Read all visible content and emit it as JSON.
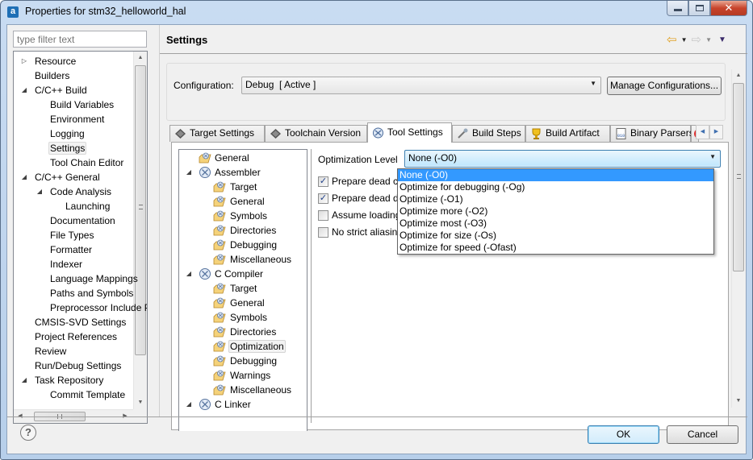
{
  "window": {
    "title": "Properties for stm32_helloworld_hal",
    "app_icon": "a",
    "controls": {
      "minimize": "minimize-icon",
      "maximize": "maximize-icon",
      "close": "close-icon"
    }
  },
  "left": {
    "filter_placeholder": "type filter text",
    "tree": [
      {
        "label": "Resource",
        "indent": 1,
        "twisty": "collapsed"
      },
      {
        "label": "Builders",
        "indent": 1,
        "twisty": "none"
      },
      {
        "label": "C/C++ Build",
        "indent": 1,
        "twisty": "expanded"
      },
      {
        "label": "Build Variables",
        "indent": 2,
        "twisty": "none"
      },
      {
        "label": "Environment",
        "indent": 2,
        "twisty": "none"
      },
      {
        "label": "Logging",
        "indent": 2,
        "twisty": "none"
      },
      {
        "label": "Settings",
        "indent": 2,
        "twisty": "none",
        "selected": true
      },
      {
        "label": "Tool Chain Editor",
        "indent": 2,
        "twisty": "none"
      },
      {
        "label": "C/C++ General",
        "indent": 1,
        "twisty": "expanded"
      },
      {
        "label": "Code Analysis",
        "indent": 2,
        "twisty": "expanded"
      },
      {
        "label": "Launching",
        "indent": 3,
        "twisty": "none"
      },
      {
        "label": "Documentation",
        "indent": 2,
        "twisty": "none"
      },
      {
        "label": "File Types",
        "indent": 2,
        "twisty": "none"
      },
      {
        "label": "Formatter",
        "indent": 2,
        "twisty": "none"
      },
      {
        "label": "Indexer",
        "indent": 2,
        "twisty": "none"
      },
      {
        "label": "Language Mappings",
        "indent": 2,
        "twisty": "none"
      },
      {
        "label": "Paths and Symbols",
        "indent": 2,
        "twisty": "none"
      },
      {
        "label": "Preprocessor Include Paths",
        "indent": 2,
        "twisty": "none"
      },
      {
        "label": "CMSIS-SVD Settings",
        "indent": 1,
        "twisty": "none"
      },
      {
        "label": "Project References",
        "indent": 1,
        "twisty": "none"
      },
      {
        "label": "Review",
        "indent": 1,
        "twisty": "none"
      },
      {
        "label": "Run/Debug Settings",
        "indent": 1,
        "twisty": "none"
      },
      {
        "label": "Task Repository",
        "indent": 1,
        "twisty": "expanded"
      },
      {
        "label": "Commit Template",
        "indent": 2,
        "twisty": "none"
      }
    ]
  },
  "main": {
    "title": "Settings",
    "nav": {
      "back": "back-arrow-icon",
      "forward": "forward-arrow-icon",
      "menu": "view-menu-icon"
    },
    "configuration": {
      "label": "Configuration:",
      "value": "Debug  [ Active ]",
      "manage_button": "Manage Configurations..."
    },
    "tabs": [
      {
        "label": "Target Settings",
        "icon": "target-settings-icon"
      },
      {
        "label": "Toolchain Version",
        "icon": "toolchain-version-icon"
      },
      {
        "label": "Tool Settings",
        "icon": "tool-settings-icon",
        "active": true
      },
      {
        "label": "Build Steps",
        "icon": "build-steps-icon"
      },
      {
        "label": "Build Artifact",
        "icon": "build-artifact-icon"
      },
      {
        "label": "Binary Parsers",
        "icon": "binary-parsers-icon"
      }
    ],
    "tool_tree": [
      {
        "label": "General",
        "indent": 1,
        "type": "option",
        "twisty": "none"
      },
      {
        "label": "Assembler",
        "indent": 1,
        "type": "tool",
        "twisty": "expanded"
      },
      {
        "label": "Target",
        "indent": 2,
        "type": "option"
      },
      {
        "label": "General",
        "indent": 2,
        "type": "option"
      },
      {
        "label": "Symbols",
        "indent": 2,
        "type": "option"
      },
      {
        "label": "Directories",
        "indent": 2,
        "type": "option"
      },
      {
        "label": "Debugging",
        "indent": 2,
        "type": "option"
      },
      {
        "label": "Miscellaneous",
        "indent": 2,
        "type": "option"
      },
      {
        "label": "C Compiler",
        "indent": 1,
        "type": "tool",
        "twisty": "expanded"
      },
      {
        "label": "Target",
        "indent": 2,
        "type": "option"
      },
      {
        "label": "General",
        "indent": 2,
        "type": "option"
      },
      {
        "label": "Symbols",
        "indent": 2,
        "type": "option"
      },
      {
        "label": "Directories",
        "indent": 2,
        "type": "option"
      },
      {
        "label": "Optimization",
        "indent": 2,
        "type": "option",
        "selected": true
      },
      {
        "label": "Debugging",
        "indent": 2,
        "type": "option"
      },
      {
        "label": "Warnings",
        "indent": 2,
        "type": "option"
      },
      {
        "label": "Miscellaneous",
        "indent": 2,
        "type": "option"
      },
      {
        "label": "C Linker",
        "indent": 1,
        "type": "tool",
        "twisty": "expanded"
      }
    ],
    "optimization": {
      "level_label": "Optimization Level",
      "level_value": "None (-O0)",
      "options": [
        {
          "label": "Prepare dead code removal",
          "visible_label": "Prepare dead cod",
          "checked": true
        },
        {
          "label": "Prepare dead data removal",
          "visible_label": "Prepare dead data",
          "checked": true
        },
        {
          "label": "Assume loading constants",
          "visible_label": "Assume loading c",
          "checked": false
        },
        {
          "label": "No strict aliasing",
          "visible_label": "No strict aliasing",
          "checked": false
        }
      ],
      "dropdown_items": [
        {
          "label": "None (-O0)",
          "selected": true
        },
        {
          "label": "Optimize for debugging (-Og)"
        },
        {
          "label": "Optimize (-O1)"
        },
        {
          "label": "Optimize more (-O2)"
        },
        {
          "label": "Optimize most (-O3)"
        },
        {
          "label": "Optimize for size (-Os)"
        },
        {
          "label": "Optimize for speed (-Ofast)"
        }
      ]
    }
  },
  "footer": {
    "help_icon": "?",
    "ok": "OK",
    "cancel": "Cancel"
  },
  "colors": {
    "selection": "#3399ff",
    "default_button_border": "#3c7fb1",
    "close_button": "#c8442c"
  }
}
